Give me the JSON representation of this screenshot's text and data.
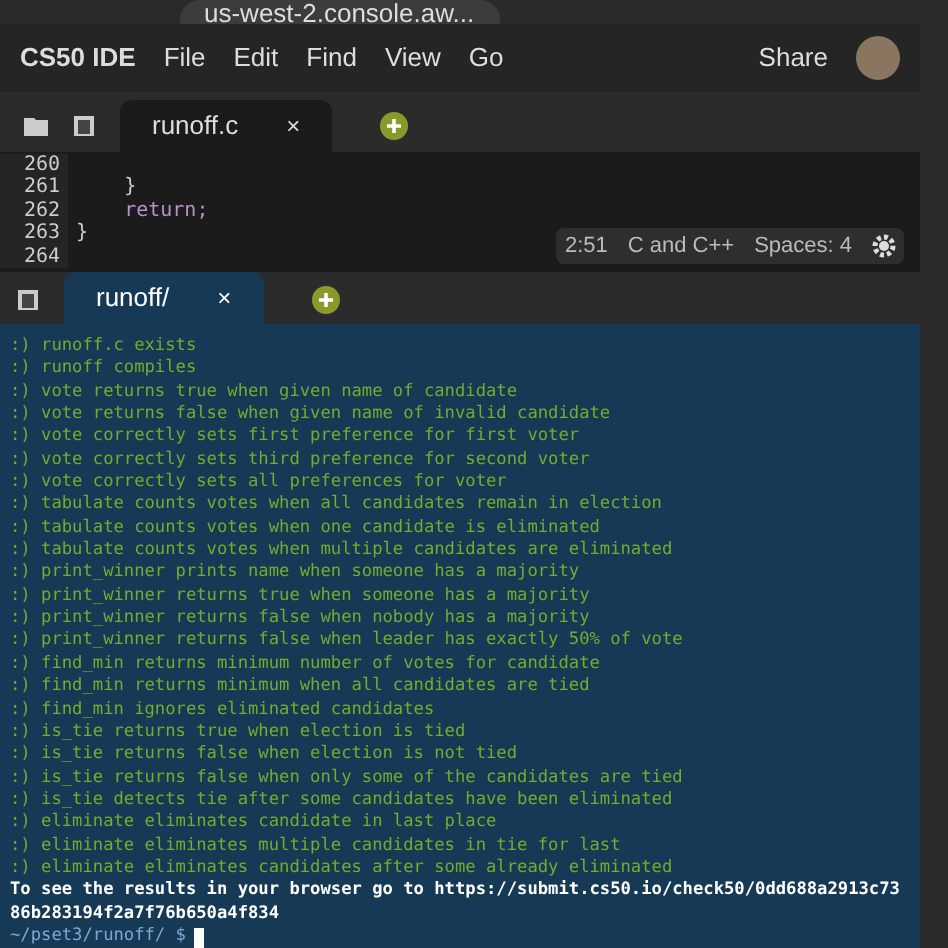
{
  "browser": {
    "url": "us-west-2.console.aw..."
  },
  "menu_bar": {
    "brand": "CS50 IDE",
    "items": [
      "File",
      "Edit",
      "Find",
      "View",
      "Go"
    ],
    "share": "Share"
  },
  "editor_tabs": [
    {
      "label": "runoff.c",
      "close": "×",
      "selected": true
    }
  ],
  "editor": {
    "lines": [
      {
        "number": "260"
      },
      {
        "number": "261",
        "code": "    }"
      },
      {
        "number": "262",
        "code": "    return;",
        "kind": "keyword"
      },
      {
        "number": "263",
        "code": "}"
      },
      {
        "number": "264"
      }
    ],
    "status": {
      "position": "2:51",
      "language": "C and C++",
      "spaces": "Spaces: 4"
    }
  },
  "terminal_tabs": [
    {
      "label": "runoff/",
      "close": "×",
      "selected": true
    }
  ],
  "terminal": {
    "checks": [
      {
        "mark": ":)",
        "text": "runoff.c exists"
      },
      {
        "mark": ":)",
        "text": "runoff compiles"
      },
      {
        "mark": ":)",
        "text": "vote returns true when given name of candidate"
      },
      {
        "mark": ":)",
        "text": "vote returns false when given name of invalid candidate"
      },
      {
        "mark": ":)",
        "text": "vote correctly sets first preference for first voter"
      },
      {
        "mark": ":)",
        "text": "vote correctly sets third preference for second voter"
      },
      {
        "mark": ":)",
        "text": "vote correctly sets all preferences for voter"
      },
      {
        "mark": ":)",
        "text": "tabulate counts votes when all candidates remain in election"
      },
      {
        "mark": ":)",
        "text": "tabulate counts votes when one candidate is eliminated"
      },
      {
        "mark": ":)",
        "text": "tabulate counts votes when multiple candidates are eliminated"
      },
      {
        "mark": ":)",
        "text": "print_winner prints name when someone has a majority"
      },
      {
        "mark": ":)",
        "text": "print_winner returns true when someone has a majority"
      },
      {
        "mark": ":)",
        "text": "print_winner returns false when nobody has a majority"
      },
      {
        "mark": ":)",
        "text": "print_winner returns false when leader has exactly 50% of vote"
      },
      {
        "mark": ":)",
        "text": "find_min returns minimum number of votes for candidate"
      },
      {
        "mark": ":)",
        "text": "find_min returns minimum when all candidates are tied"
      },
      {
        "mark": ":)",
        "text": "find_min ignores eliminated candidates"
      },
      {
        "mark": ":)",
        "text": "is_tie returns true when election is tied"
      },
      {
        "mark": ":)",
        "text": "is_tie returns false when election is not tied"
      },
      {
        "mark": ":)",
        "text": "is_tie returns false when only some of the candidates are tied"
      },
      {
        "mark": ":)",
        "text": "is_tie detects tie after some candidates have been eliminated"
      },
      {
        "mark": ":)",
        "text": "eliminate eliminates candidate in last place"
      },
      {
        "mark": ":)",
        "text": "eliminate eliminates multiple candidates in tie for last"
      },
      {
        "mark": ":)",
        "text": "eliminate eliminates candidates after some already eliminated"
      }
    ],
    "results": [
      "To see the results in your browser go to https://submit.cs50.io/check50/0dd688a2913c73",
      "86b283194f2a7f76b650a4f834"
    ],
    "prompt": "~/pset3/runoff/ $"
  }
}
